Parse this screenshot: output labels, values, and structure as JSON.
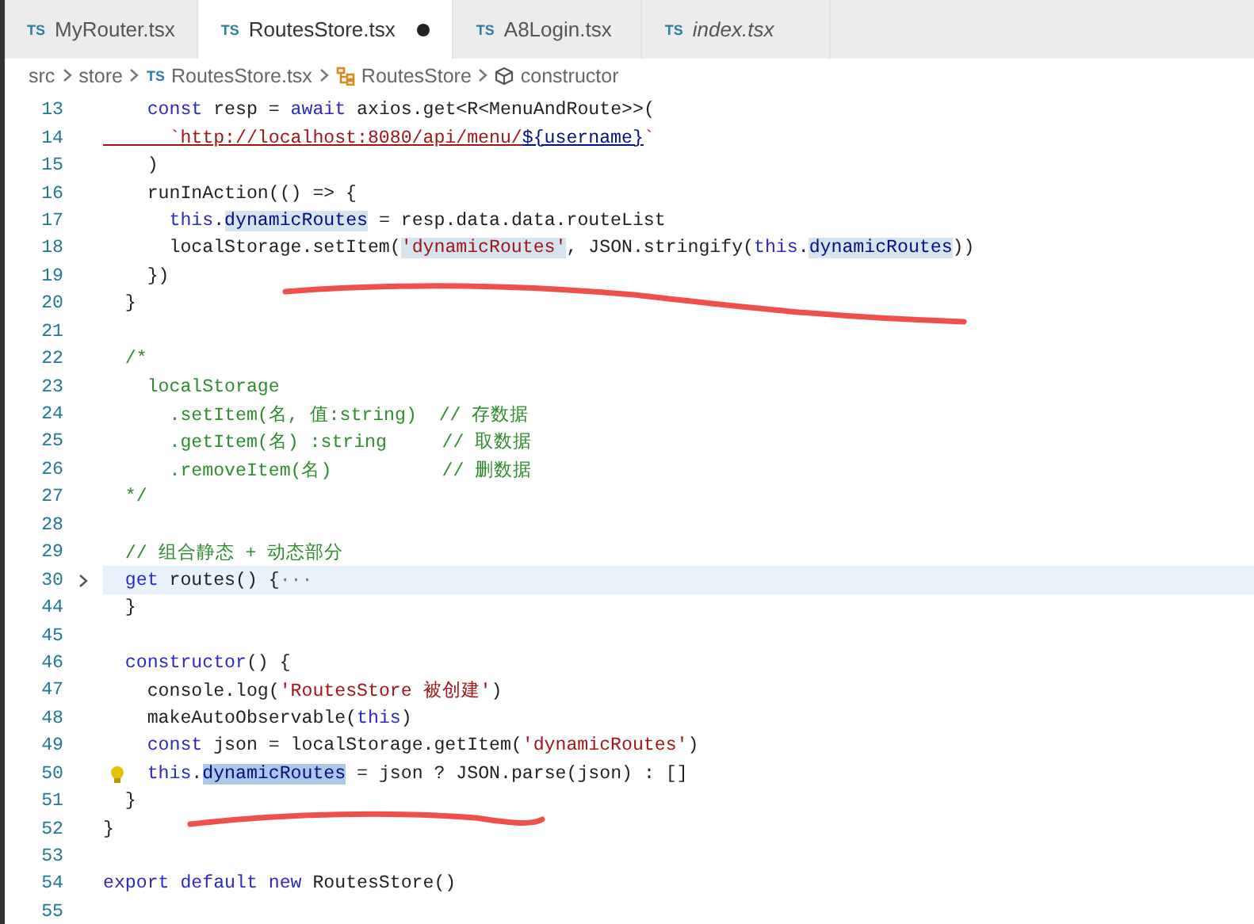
{
  "tabs": [
    {
      "badge": "TS",
      "label": "MyRouter.tsx",
      "selected": false,
      "modified": false,
      "preview": false
    },
    {
      "badge": "TS",
      "label": "RoutesStore.tsx",
      "selected": true,
      "modified": true,
      "preview": false
    },
    {
      "badge": "TS",
      "label": "A8Login.tsx",
      "selected": false,
      "modified": false,
      "preview": false
    },
    {
      "badge": "TS",
      "label": "index.tsx",
      "selected": false,
      "modified": false,
      "preview": true
    }
  ],
  "breadcrumb": [
    {
      "kind": "folder",
      "label": "src"
    },
    {
      "kind": "folder",
      "label": "store"
    },
    {
      "kind": "file",
      "badge": "TS",
      "label": "RoutesStore.tsx"
    },
    {
      "kind": "class",
      "label": "RoutesStore"
    },
    {
      "kind": "method",
      "label": "constructor"
    }
  ],
  "lines": [
    {
      "number": "13",
      "tokens": [
        {
          "kind": "kw",
          "text": "    const"
        },
        {
          "kind": "plain",
          "text": " resp = "
        },
        {
          "kind": "kw",
          "text": "await"
        },
        {
          "kind": "plain",
          "text": " axios.get<R<MenuAndRoute>>("
        }
      ]
    },
    {
      "number": "14",
      "tokens": [
        {
          "kind": "url",
          "text": "      `http://localhost:8080/api/menu/"
        },
        {
          "kind": "urlvar",
          "text": "${username}"
        },
        {
          "kind": "str",
          "text": "`"
        }
      ]
    },
    {
      "number": "15",
      "tokens": [
        {
          "kind": "plain",
          "text": "    )"
        }
      ]
    },
    {
      "number": "16",
      "tokens": [
        {
          "kind": "plain",
          "text": "    runInAction(() => {"
        }
      ]
    },
    {
      "number": "17",
      "tokens": [
        {
          "kind": "kw",
          "text": "      this"
        },
        {
          "kind": "plain",
          "text": "."
        },
        {
          "kind": "var",
          "text": "dynamicRoutes",
          "highlight": true,
          "selected": false
        },
        {
          "kind": "plain",
          "text": " = resp.data.data.routeList"
        }
      ]
    },
    {
      "number": "18",
      "tokens": [
        {
          "kind": "plain",
          "text": "      localStorage.setItem("
        },
        {
          "kind": "str",
          "text": "'dynamicRoutes'",
          "highlight": true,
          "selected": false
        },
        {
          "kind": "plain",
          "text": ", JSON.stringify("
        },
        {
          "kind": "kw",
          "text": "this"
        },
        {
          "kind": "plain",
          "text": "."
        },
        {
          "kind": "var",
          "text": "dynamicRoutes",
          "highlight": true,
          "selected": false
        },
        {
          "kind": "plain",
          "text": "))"
        }
      ]
    },
    {
      "number": "19",
      "tokens": [
        {
          "kind": "plain",
          "text": "    })"
        }
      ]
    },
    {
      "number": "20",
      "tokens": [
        {
          "kind": "plain",
          "text": "  }"
        }
      ]
    },
    {
      "number": "21"
    },
    {
      "number": "22",
      "tokens": [
        {
          "kind": "cmt",
          "text": "  /*"
        }
      ]
    },
    {
      "number": "23",
      "tokens": [
        {
          "kind": "cmt",
          "text": "    localStorage"
        }
      ]
    },
    {
      "number": "24",
      "tokens": [
        {
          "kind": "cmt",
          "text": "      .setItem(名, 值:string)  // 存数据"
        }
      ]
    },
    {
      "number": "25",
      "tokens": [
        {
          "kind": "cmt",
          "text": "      .getItem(名) :string     // 取数据"
        }
      ]
    },
    {
      "number": "26",
      "tokens": [
        {
          "kind": "cmt",
          "text": "      .removeItem(名)          // 删数据"
        }
      ]
    },
    {
      "number": "27",
      "tokens": [
        {
          "kind": "cmt",
          "text": "  */"
        }
      ]
    },
    {
      "number": "28"
    },
    {
      "number": "29",
      "tokens": [
        {
          "kind": "cmt",
          "text": "  // 组合静态 + 动态部分"
        }
      ]
    },
    {
      "number": "30",
      "folded": true,
      "highlighted": true,
      "tokens": [
        {
          "kind": "kw",
          "text": "  get"
        },
        {
          "kind": "plain",
          "text": " routes() {"
        },
        {
          "kind": "fold",
          "text": "···"
        }
      ]
    },
    {
      "number": "44",
      "tokens": [
        {
          "kind": "plain",
          "text": "  }"
        }
      ]
    },
    {
      "number": "45"
    },
    {
      "number": "46",
      "tokens": [
        {
          "kind": "kw",
          "text": "  constructor"
        },
        {
          "kind": "plain",
          "text": "() {"
        }
      ]
    },
    {
      "number": "47",
      "tokens": [
        {
          "kind": "plain",
          "text": "    console.log("
        },
        {
          "kind": "str",
          "text": "'RoutesStore 被创建'"
        },
        {
          "kind": "plain",
          "text": ")"
        }
      ]
    },
    {
      "number": "48",
      "tokens": [
        {
          "kind": "plain",
          "text": "    makeAutoObservable("
        },
        {
          "kind": "kw",
          "text": "this"
        },
        {
          "kind": "plain",
          "text": ")"
        }
      ]
    },
    {
      "number": "49",
      "tokens": [
        {
          "kind": "kw",
          "text": "    const"
        },
        {
          "kind": "plain",
          "text": " json = localStorage.getItem("
        },
        {
          "kind": "str",
          "text": "'dynamicRoutes'"
        },
        {
          "kind": "plain",
          "text": ")"
        }
      ]
    },
    {
      "number": "50",
      "lightbulb": true,
      "tokens": [
        {
          "kind": "kw",
          "text": "    this"
        },
        {
          "kind": "plain",
          "text": "."
        },
        {
          "kind": "var",
          "text": "dynamicRoutes",
          "highlight": true,
          "selected": true
        },
        {
          "kind": "plain",
          "text": " = json ? JSON.parse(json) : []"
        }
      ]
    },
    {
      "number": "51",
      "tokens": [
        {
          "kind": "plain",
          "text": "  }"
        }
      ]
    },
    {
      "number": "52",
      "tokens": [
        {
          "kind": "plain",
          "text": "}"
        }
      ]
    },
    {
      "number": "53"
    },
    {
      "number": "54",
      "tokens": [
        {
          "kind": "kw",
          "text": "export default new"
        },
        {
          "kind": "plain",
          "text": " RoutesStore()"
        }
      ]
    },
    {
      "number": "55"
    }
  ],
  "ink_marks": [
    {
      "kind": "underline"
    },
    {
      "kind": "underline"
    }
  ]
}
